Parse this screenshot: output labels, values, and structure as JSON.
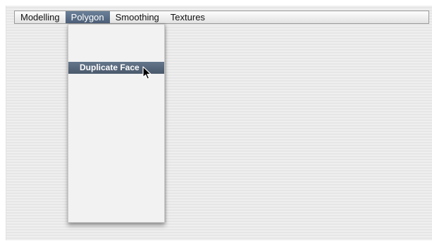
{
  "menubar": {
    "items": [
      {
        "label": "Modelling",
        "active": false
      },
      {
        "label": "Polygon",
        "active": true
      },
      {
        "label": "Smoothing",
        "active": false
      },
      {
        "label": "Textures",
        "active": false
      }
    ]
  },
  "dropdown": {
    "items": [
      {
        "label": "Duplicate Face",
        "highlighted": true
      }
    ]
  },
  "icons": {
    "pointer": "arrow-cursor-icon"
  },
  "colors": {
    "active_menu": "#56697f",
    "highlight": "#56667a",
    "background": "#ececec"
  }
}
